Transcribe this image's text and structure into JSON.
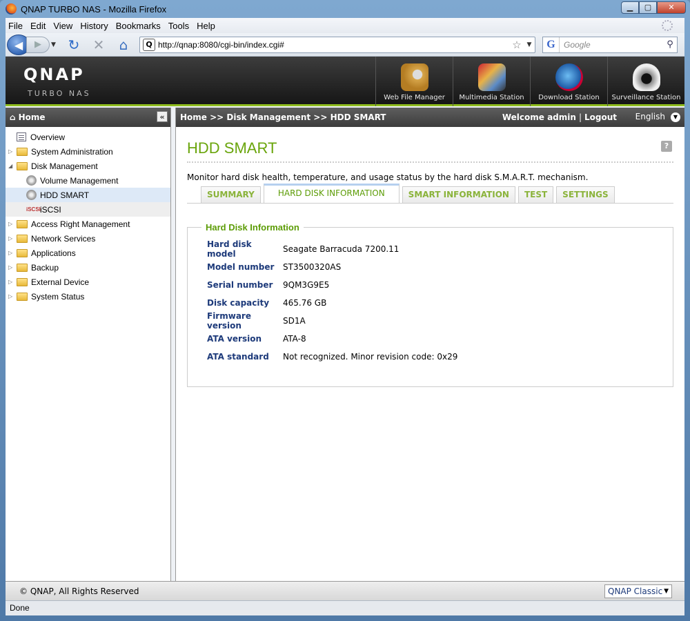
{
  "window": {
    "title": "QNAP TURBO NAS - Mozilla Firefox"
  },
  "menu": [
    "File",
    "Edit",
    "View",
    "History",
    "Bookmarks",
    "Tools",
    "Help"
  ],
  "navbar": {
    "url": "http://qnap:8080/cgi-bin/index.cgi#",
    "search_placeholder": "Google"
  },
  "header": {
    "logo": "QNAP",
    "subtitle": "TURBO NAS",
    "apps": [
      {
        "label": "Web File Manager",
        "icon": "web-file-manager-icon"
      },
      {
        "label": "Multimedia Station",
        "icon": "multimedia-station-icon"
      },
      {
        "label": "Download Station",
        "icon": "download-station-icon"
      },
      {
        "label": "Surveillance Station",
        "icon": "surveillance-station-icon"
      }
    ]
  },
  "sidebar": {
    "title": "Home",
    "items": [
      {
        "label": "Overview"
      },
      {
        "label": "System Administration"
      },
      {
        "label": "Disk Management"
      },
      {
        "label": "Volume Management"
      },
      {
        "label": "HDD SMART"
      },
      {
        "label": "iSCSI"
      },
      {
        "label": "Access Right Management"
      },
      {
        "label": "Network Services"
      },
      {
        "label": "Applications"
      },
      {
        "label": "Backup"
      },
      {
        "label": "External Device"
      },
      {
        "label": "System Status"
      }
    ]
  },
  "breadcrumb": {
    "path": "Home >> Disk Management >> HDD SMART",
    "welcome": "Welcome admin",
    "logout": "Logout",
    "language": "English"
  },
  "main": {
    "title": "HDD SMART",
    "description": "Monitor hard disk health, temperature, and usage status by the hard disk S.M.A.R.T. mechanism.",
    "tabs": [
      "SUMMARY",
      "HARD DISK INFORMATION",
      "SMART INFORMATION",
      "TEST",
      "SETTINGS"
    ],
    "active_tab": "HARD DISK INFORMATION",
    "section_title": "Hard Disk Information",
    "fields": [
      {
        "label": "Hard disk model",
        "value": "Seagate Barracuda 7200.11"
      },
      {
        "label": "Model number",
        "value": "ST3500320AS"
      },
      {
        "label": "Serial number",
        "value": "9QM3G9E5"
      },
      {
        "label": "Disk capacity",
        "value": "465.76 GB"
      },
      {
        "label": "Firmware version",
        "value": "SD1A"
      },
      {
        "label": "ATA version",
        "value": "ATA-8"
      },
      {
        "label": "ATA standard",
        "value": "Not recognized. Minor revision code: 0x29"
      }
    ]
  },
  "footer": {
    "copyright": "© QNAP, All Rights Reserved",
    "theme": "QNAP Classic"
  },
  "status": "Done"
}
